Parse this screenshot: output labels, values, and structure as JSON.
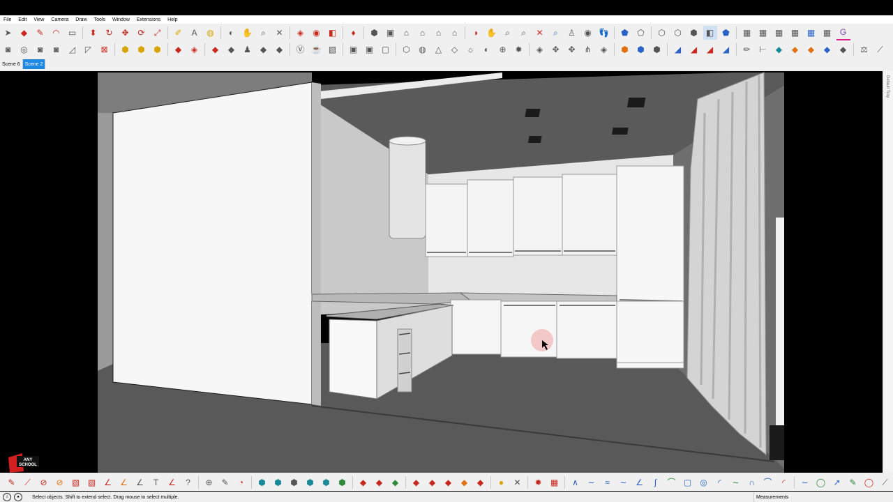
{
  "menubar": {
    "items": [
      "File",
      "Edit",
      "View",
      "Camera",
      "Draw",
      "Tools",
      "Window",
      "Extensions",
      "Help"
    ]
  },
  "scene_tabs": [
    {
      "label": "Scene 6",
      "active": false
    },
    {
      "label": "Scene 2",
      "active": true
    }
  ],
  "tray": {
    "label": "Default Tray"
  },
  "status": {
    "hint": "Select objects. Shift to extend select. Drag mouse to select multiple.",
    "measurements_label": "Measurements"
  },
  "logo": {
    "text": "ANY SCHOOL"
  },
  "colors": {
    "active_tab": "#1e88e5",
    "accent_red": "#c8281e",
    "hover_highlight": "#f2c0c0"
  }
}
